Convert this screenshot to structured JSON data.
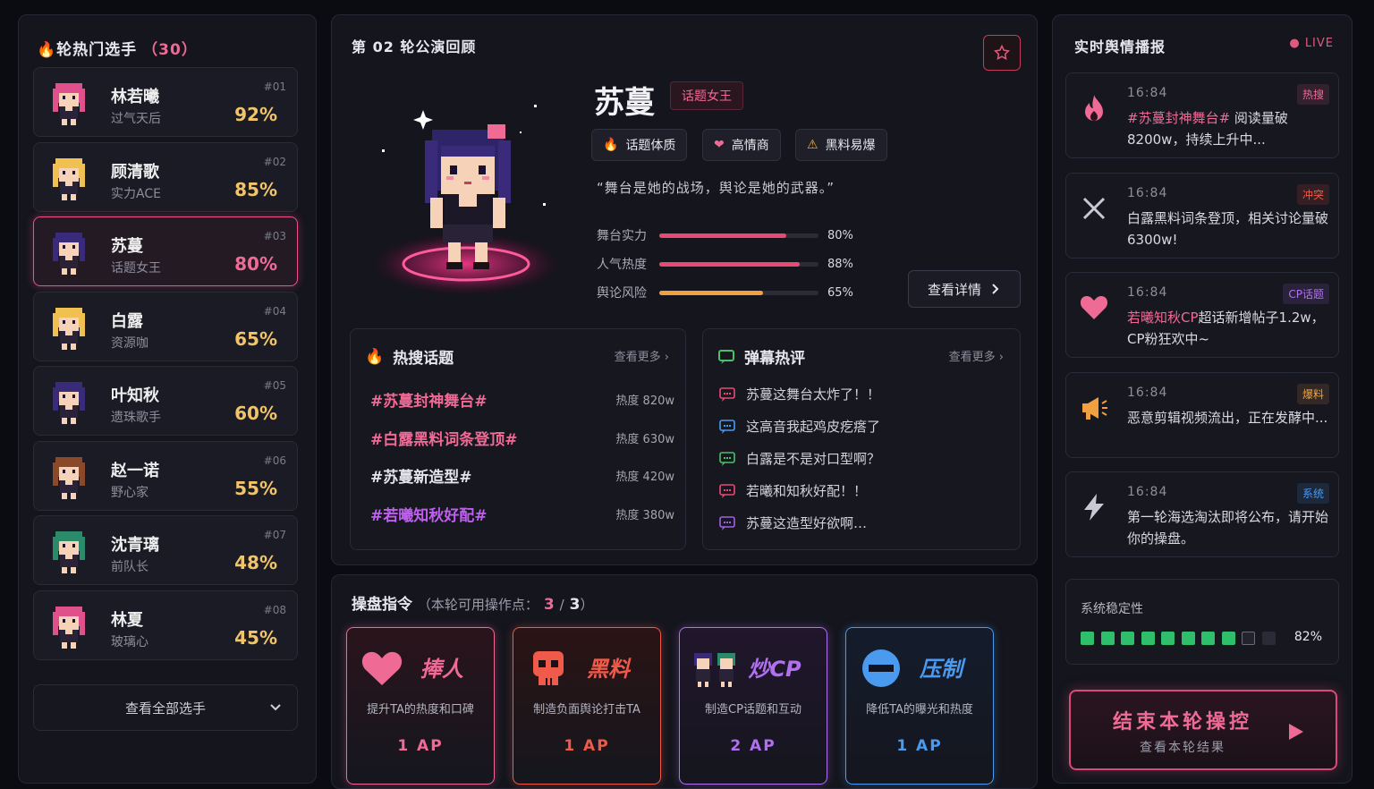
{
  "left": {
    "title": "轮热门选手",
    "count": "（30）",
    "players": [
      {
        "name": "林若曦",
        "tag": "过气天后",
        "rank": "#01",
        "pct": "92%",
        "hair": "#e0508c"
      },
      {
        "name": "顾清歌",
        "tag": "实力ACE",
        "rank": "#02",
        "pct": "85%",
        "hair": "#f0c050"
      },
      {
        "name": "苏蔓",
        "tag": "话题女王",
        "rank": "#03",
        "pct": "80%",
        "hair": "#3a2a7a"
      },
      {
        "name": "白露",
        "tag": "资源咖",
        "rank": "#04",
        "pct": "65%",
        "hair": "#f0c050"
      },
      {
        "name": "叶知秋",
        "tag": "遗珠歌手",
        "rank": "#05",
        "pct": "60%",
        "hair": "#3a2a7a"
      },
      {
        "name": "赵一诺",
        "tag": "野心家",
        "rank": "#06",
        "pct": "55%",
        "hair": "#8a4a2a"
      },
      {
        "name": "沈青璃",
        "tag": "前队长",
        "rank": "#07",
        "pct": "48%",
        "hair": "#2a8a6a"
      },
      {
        "name": "林夏",
        "tag": "玻璃心",
        "rank": "#08",
        "pct": "45%",
        "hair": "#e0508c"
      }
    ],
    "view_all": "查看全部选手"
  },
  "center": {
    "title": "第 02 轮公演回顾",
    "name": "苏蔓",
    "tag": "话题女王",
    "traits": [
      "话题体质",
      "高情商",
      "黑料易爆"
    ],
    "quote": "“舞台是她的战场，舆论是她的武器。”",
    "stats": [
      {
        "label": "舞台实力",
        "value": "80%",
        "level": 0.8,
        "color": "#e84a74"
      },
      {
        "label": "人气热度",
        "value": "88%",
        "level": 0.88,
        "color": "#e84a74"
      },
      {
        "label": "舆论风险",
        "value": "65%",
        "level": 0.65,
        "color": "#f0a040"
      }
    ],
    "detail_btn": "查看详情",
    "hot": {
      "title": "热搜话题",
      "more": "查看更多",
      "items": [
        {
          "topic": "#苏蔓封神舞台#",
          "heat": "热度 820w",
          "color": "#f06a96"
        },
        {
          "topic": "#白露黑料词条登顶#",
          "heat": "热度 630w",
          "color": "#f06a96"
        },
        {
          "topic": "#苏蔓新造型#",
          "heat": "热度 420w",
          "color": "#e4e4ec"
        },
        {
          "topic": "#若曦知秋好配#",
          "heat": "热度 380w",
          "color": "#c05ef0"
        }
      ]
    },
    "danmaku": {
      "title": "弹幕热评",
      "more": "查看更多",
      "items": [
        {
          "text": "苏蔓这舞台太炸了！！",
          "color": "#e84a74"
        },
        {
          "text": "这高音我起鸡皮疙瘩了",
          "color": "#4a9af0"
        },
        {
          "text": "白露是不是对口型啊？",
          "color": "#4ac06a"
        },
        {
          "text": "若曦和知秋好配！！",
          "color": "#e84a74"
        },
        {
          "text": "苏蔓这造型好欲啊…",
          "color": "#a060e0"
        }
      ]
    }
  },
  "ops": {
    "title": "操盘指令",
    "sub": "（本轮可用操作点：",
    "points": "3",
    "slash": "/",
    "total": "3",
    "close": "）",
    "cards": [
      {
        "title": "捧人",
        "desc": "提升TA的热度和口碑",
        "ap": "1 AP",
        "color": "#f06a96",
        "icon": "heart-icon"
      },
      {
        "title": "黑料",
        "desc": "制造负面舆论打击TA",
        "ap": "1 AP",
        "color": "#f05a4a",
        "icon": "skull-icon"
      },
      {
        "title": "炒CP",
        "desc": "制造CP话题和互动",
        "ap": "2 AP",
        "color": "#b070f0",
        "icon": "cp-icon"
      },
      {
        "title": "压制",
        "desc": "降低TA的曝光和热度",
        "ap": "1 AP",
        "color": "#4a9af0",
        "icon": "minus-icon"
      }
    ]
  },
  "right": {
    "title": "实时舆情播报",
    "live": "LIVE",
    "news": [
      {
        "time": "16:84",
        "badge": "热搜",
        "badge_color": "#f06a96",
        "icon": "fire-icon",
        "hl": "#苏蔓封神舞台#",
        "text": " 阅读量破8200w，持续上升中..."
      },
      {
        "time": "16:84",
        "badge": "冲突",
        "badge_color": "#f05a4a",
        "icon": "cross-icon",
        "hl": "",
        "text": "白露黑料词条登顶，相关讨论量破 6300w!"
      },
      {
        "time": "16:84",
        "badge": "CP话题",
        "badge_color": "#b070f0",
        "icon": "heart-icon",
        "hl": "若曦知秋CP",
        "text": "超话新增帖子1.2w，CP粉狂欢中~"
      },
      {
        "time": "16:84",
        "badge": "爆料",
        "badge_color": "#f0a040",
        "icon": "megaphone-icon",
        "hl": "",
        "text": "恶意剪辑视频流出，正在发酵中..."
      },
      {
        "time": "16:84",
        "badge": "系统",
        "badge_color": "#4a9af0",
        "icon": "lightning-icon",
        "hl": "",
        "text": "第一轮海选淘汰即将公布，请开始你的操盘。"
      }
    ],
    "stability_label": "系统稳定性",
    "stability_value": "82%",
    "stability_level": 0.82,
    "end_title": "结束本轮操控",
    "end_sub": "查看本轮结果"
  }
}
